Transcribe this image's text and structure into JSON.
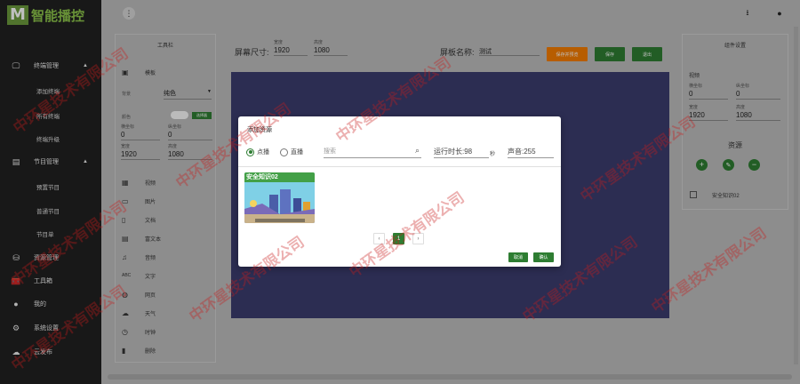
{
  "app": {
    "logo_letter": "M",
    "logo_text": "智能播控"
  },
  "sidebar": {
    "groups": [
      {
        "label": "终端管理",
        "icon": "monitor-icon",
        "subs": [
          "添加终端",
          "所有终端",
          "终端升级"
        ]
      },
      {
        "label": "节目管理",
        "icon": "program-icon",
        "subs": [
          "预置节目",
          "普通节目",
          "节目单"
        ]
      },
      {
        "label": "资源管理",
        "icon": "resource-icon",
        "subs": []
      },
      {
        "label": "工具箱",
        "icon": "toolbox-icon",
        "subs": []
      },
      {
        "label": "我的",
        "icon": "user-icon",
        "subs": []
      },
      {
        "label": "系统设置",
        "icon": "settings-icon",
        "subs": []
      },
      {
        "label": "云发布",
        "icon": "cloud-icon",
        "subs": []
      }
    ]
  },
  "toolbox": {
    "title": "工具栏",
    "bg_label": "背景",
    "bg_value": "纯色",
    "color_label": "颜色",
    "color_btn": "选择器",
    "x_label": "横坐标",
    "y_label": "纵坐标",
    "x_value": "0",
    "y_value": "0",
    "w_label": "宽度",
    "h_label": "高度",
    "w_value": "1920",
    "h_value": "1080",
    "items": [
      {
        "label": "模板",
        "icon": "template-icon"
      },
      {
        "label": "视频",
        "icon": "video-icon"
      },
      {
        "label": "图片",
        "icon": "image-icon"
      },
      {
        "label": "文档",
        "icon": "document-icon"
      },
      {
        "label": "富文本",
        "icon": "richtext-icon"
      },
      {
        "label": "音频",
        "icon": "audio-icon"
      },
      {
        "label": "文字",
        "icon": "text-icon"
      },
      {
        "label": "网页",
        "icon": "web-icon"
      },
      {
        "label": "天气",
        "icon": "weather-icon"
      },
      {
        "label": "时钟",
        "icon": "clock-icon"
      },
      {
        "label": "删除",
        "icon": "trash-icon"
      }
    ]
  },
  "canvas": {
    "screen_size_label": "屏幕尺寸:",
    "width_label": "宽度",
    "height_label": "高度",
    "width": "1920",
    "height": "1080",
    "name_label": "屏板名称:",
    "name_value": "测试",
    "save_as_template": "保存并预览",
    "save": "保存",
    "exit": "退出",
    "screen_color": "#3b3d6e"
  },
  "rightpanel": {
    "title": "组件设置",
    "section": "视频",
    "x_label": "横坐标",
    "y_label": "纵坐标",
    "x": "0",
    "y": "0",
    "w_label": "宽度",
    "h_label": "高度",
    "w": "1920",
    "h": "1080",
    "resources_title": "资源",
    "resource_item": "安全知识02"
  },
  "dialog": {
    "title": "添加资源",
    "radio_on_demand": "点播",
    "radio_live": "直播",
    "search_placeholder": "搜索",
    "duration_label": "运行时长:",
    "duration_value": "98",
    "duration_unit": "秒",
    "volume_label": "声音:",
    "volume_value": "255",
    "card_title": "安全知识02",
    "page_prev": "‹",
    "page_current": "1",
    "page_next": "›",
    "cancel": "取消",
    "confirm": "确认"
  },
  "watermark": "中环星技术有限公司",
  "colors": {
    "accent": "#2e7d32",
    "orange": "#f57c00",
    "sidebar": "#212121"
  }
}
